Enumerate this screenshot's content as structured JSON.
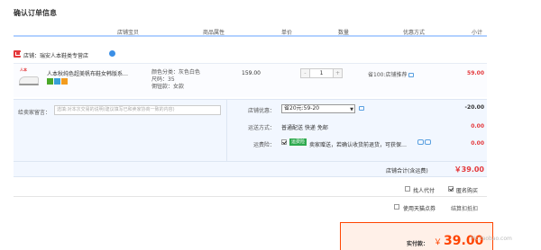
{
  "page_title": "确认订单信息",
  "columns": [
    "店铺宝贝",
    "商品属性",
    "单价",
    "数量",
    "优惠方式",
    "小计"
  ],
  "shop": {
    "label": "店铺：瑞安人本鞋类专营店"
  },
  "item": {
    "name": "人本秋纯色超美帆布鞋女韩版系…",
    "attrs": [
      "颜色分类：灰色白色",
      "尺码：35",
      "佣钮款：女款"
    ],
    "price": "159.00",
    "qty_minus": "-",
    "quantity": "1",
    "qty_plus": "+",
    "discount": "省100:店铺推荐",
    "subtotal": "59.00"
  },
  "memo": {
    "label": "给卖家留言：",
    "placeholder": "选填:对本次交易的说明(建议填写已和卖家协商一致的内容)"
  },
  "shop_coupon": {
    "label": "店铺优惠：",
    "selected": "省20元:59-20",
    "amount": "-20.00"
  },
  "shipping": {
    "label": "运送方式：",
    "value": "普通配送 快递 免邮",
    "amount": "0.00"
  },
  "insurance": {
    "label": "运费险：",
    "tag": "运费险",
    "text": "卖家赠送，若确认收货前退货，可获保…",
    "amount": "0.00"
  },
  "shop_total": {
    "label": "店铺合计(含运费)",
    "amount": "￥39.00"
  },
  "options": {
    "anonymous_label": "匿名购买",
    "friend_pay_label": "找人代付",
    "tmall_points_label": "使用天猫点券",
    "points_hint": "结算扣抵扣"
  },
  "payment": {
    "label": "实付款：",
    "currency": "￥",
    "amount": "39.00"
  },
  "watermark": "Pic.taobao.com",
  "colors": {
    "accent": "#ff4400",
    "price_red": "#e4393c",
    "panel_blue": "#f2f7ff"
  }
}
